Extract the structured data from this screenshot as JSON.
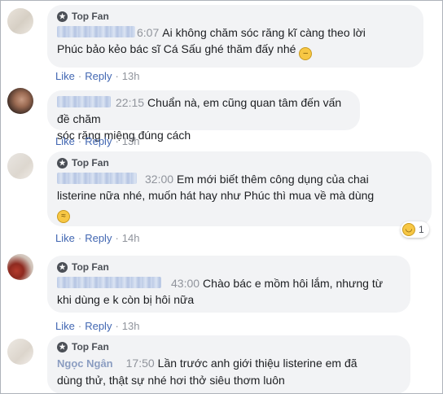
{
  "badge_label": "Top Fan",
  "like_label": "Like",
  "reply_label": "Reply",
  "comments": [
    {
      "name": "",
      "time": "6:07",
      "text_line1": "Ai không chăm sóc răng kĩ càng theo lời",
      "text_line2": "Phúc bảo kẻo bác sĩ Cá Sấu ghé thăm đấy nhé",
      "emoji": "😑",
      "ago": "13h"
    },
    {
      "name": "",
      "time": "22:15",
      "text_line1": "Chuẩn nà, em cũng quan tâm đến vấn đề chăm",
      "text_line2": "sóc răng miệng đúng cách",
      "ago": "13h"
    },
    {
      "name": "",
      "time": "32:00",
      "text_line1": "Em mới biết thêm công dụng của chai",
      "text_line2": "listerine nữa nhé, muốn hát hay như Phúc thì mua về mà dùng",
      "emoji": "🤣",
      "ago": "14h",
      "reaction_count": "1",
      "reaction_emoji": "😆"
    },
    {
      "name": "",
      "time": "43:00",
      "text_line1": "Chào bác e mồm hôi lắm, nhưng từ",
      "text_line2": "khi dùng e k còn bị hôi nữa",
      "ago": "13h"
    },
    {
      "name": "Ngọc Ngân",
      "time": "17:50",
      "text_line1": "Lần trước anh giới thiệu listerine em đã",
      "text_line2": "dùng thử, thật sự nhé hơi thở siêu thơm luôn"
    }
  ],
  "colors": {
    "bubble": "#f2f3f5",
    "link": "#4267b2",
    "meta": "#90949c",
    "name": "#385898"
  }
}
